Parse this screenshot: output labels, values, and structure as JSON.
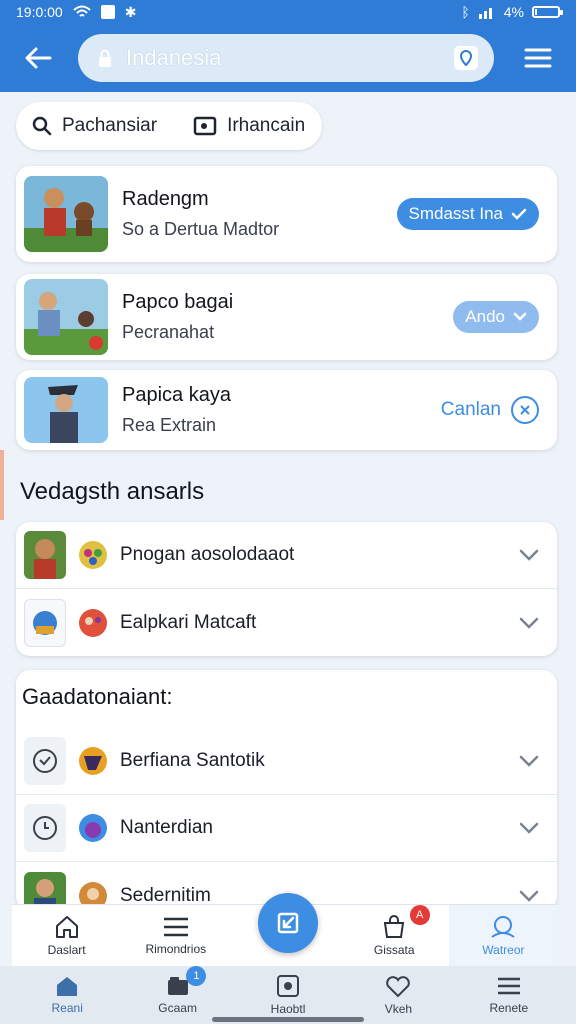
{
  "status_bar": {
    "time": "19:0:00",
    "battery": "4%"
  },
  "app_bar": {
    "url": "Indanesia"
  },
  "filters": [
    {
      "label": "Pachansiar"
    },
    {
      "label": "Irhancain"
    }
  ],
  "games": [
    {
      "title": "Radengm",
      "subtitle": "So a Dertua Madtor",
      "action": "Smdasst Ina"
    },
    {
      "title": "Papco bagai",
      "subtitle": "Pecranahat",
      "action": "Ando"
    },
    {
      "title": "Papica kaya",
      "subtitle": "Rea Extrain",
      "action": "Canlan"
    }
  ],
  "section1": {
    "title": "Vedagsth ansarls",
    "rows": [
      {
        "label": "Pnogan aosolodaaot"
      },
      {
        "label": "Ealpkari Matcaft"
      }
    ]
  },
  "section2": {
    "title": "Gaadatonaiant:",
    "rows": [
      {
        "label": "Berfiana Santotik"
      },
      {
        "label": "Nanterdian"
      },
      {
        "label": "Sedernitim"
      }
    ]
  },
  "nav_top": [
    {
      "label": "Daslart",
      "icon": "home-outline-icon"
    },
    {
      "label": "Rimondrios",
      "icon": "list-icon"
    },
    {
      "label": "Gissata",
      "icon": "shop-bag-icon",
      "badge": "A"
    },
    {
      "label": "Watreor",
      "icon": "profile-icon"
    }
  ],
  "nav_bottom": [
    {
      "label": "Reani",
      "icon": "home-icon"
    },
    {
      "label": "Gcaam",
      "icon": "folder-icon",
      "badge": "1"
    },
    {
      "label": "Haobtl",
      "icon": "game-icon"
    },
    {
      "label": "Vkeh",
      "icon": "heart-icon"
    },
    {
      "label": "Renete",
      "icon": "settings-list-icon"
    }
  ],
  "colors": {
    "primary": "#2f7cd6",
    "accent": "#3d8de2",
    "badge_red": "#e53935",
    "badge_blue": "#3d8de2"
  }
}
